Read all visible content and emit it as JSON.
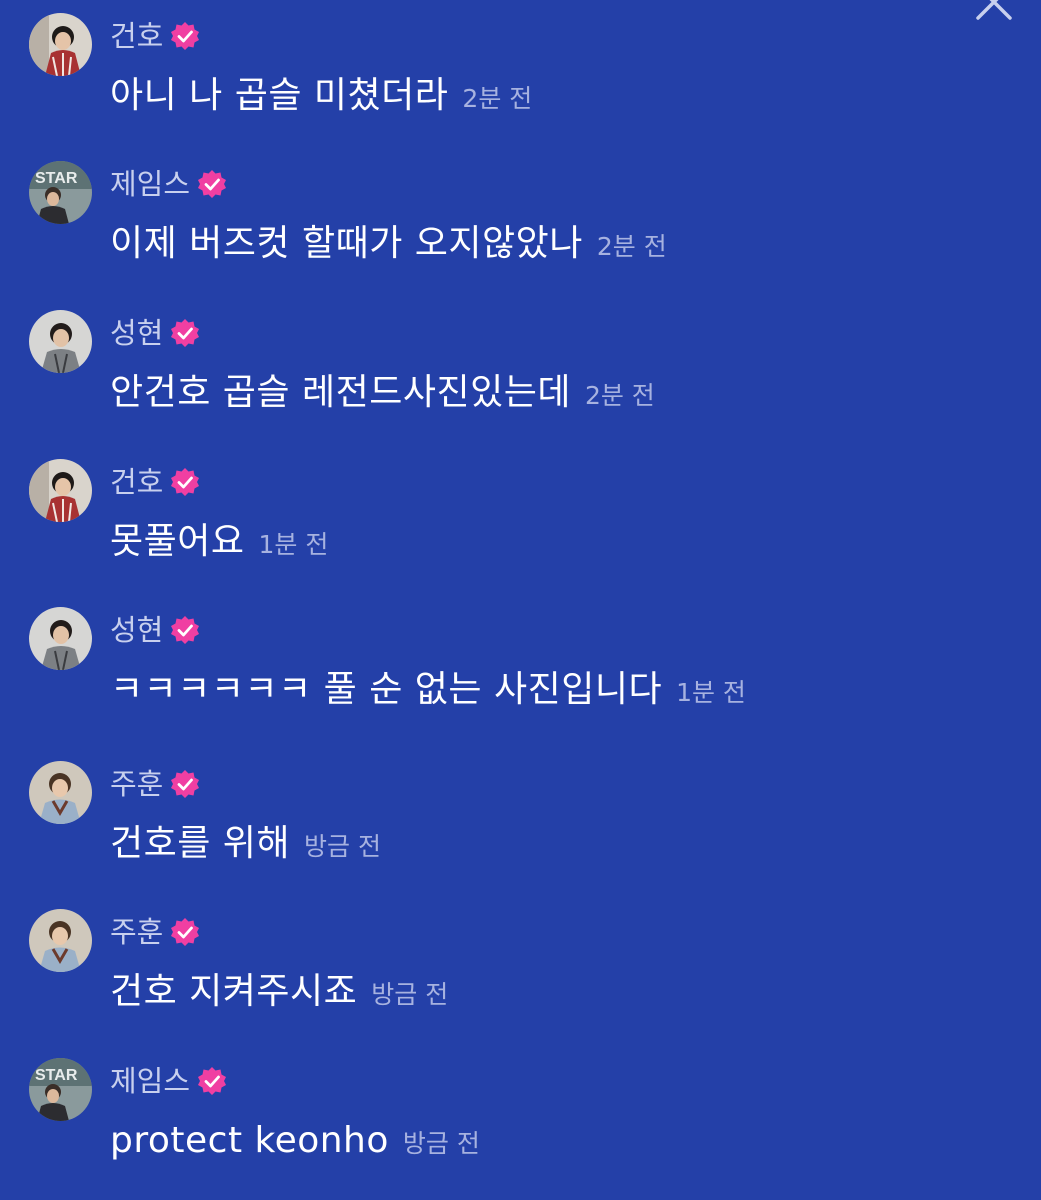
{
  "colors": {
    "background": "#2440a8",
    "badge": "#f03fa2",
    "username": "#c8d0ee",
    "message": "#ffffff",
    "timestamp": "#a7b2e0"
  },
  "close_icon": "close-icon",
  "messages": [
    {
      "user": "건호",
      "avatar": "avatar-keonho",
      "verified": true,
      "text": "아니 나 곱슬 미쳤더라",
      "time": "2분 전"
    },
    {
      "user": "제임스",
      "avatar": "avatar-james",
      "verified": true,
      "text": "이제 버즈컷 할때가 오지않았나",
      "time": "2분 전"
    },
    {
      "user": "성현",
      "avatar": "avatar-sunghyeon",
      "verified": true,
      "text": "안건호 곱슬 레전드사진있는데",
      "time": "2분 전"
    },
    {
      "user": "건호",
      "avatar": "avatar-keonho",
      "verified": true,
      "text": "못풀어요",
      "time": "1분 전"
    },
    {
      "user": "성현",
      "avatar": "avatar-sunghyeon",
      "verified": true,
      "text": "ㅋㅋㅋㅋㅋㅋ 풀 순 없는 사진입니다",
      "time": "1분 전"
    },
    {
      "user": "주훈",
      "avatar": "avatar-juhoon",
      "verified": true,
      "text": "건호를 위해",
      "time": "방금 전"
    },
    {
      "user": "주훈",
      "avatar": "avatar-juhoon",
      "verified": true,
      "text": "건호 지켜주시죠",
      "time": "방금 전"
    },
    {
      "user": "제임스",
      "avatar": "avatar-james",
      "verified": true,
      "text": "protect keonho",
      "time": "방금 전"
    }
  ]
}
